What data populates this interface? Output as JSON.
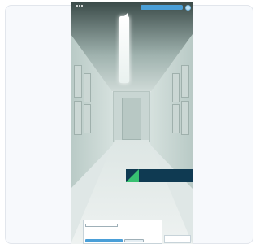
{
  "phone": {
    "status_time": "",
    "brand": ""
  },
  "banner": {
    "line1": "",
    "line2": ""
  },
  "consent": {
    "text": "",
    "field_value": "",
    "accept_label": "",
    "decline_label": ""
  },
  "colors": {
    "accent": "#4a9fd8",
    "banner_bg": "#0f3a52",
    "banner_mark": "#38c172"
  },
  "icons": {
    "menu": "menu-icon",
    "logo": "brand-logo-icon"
  }
}
